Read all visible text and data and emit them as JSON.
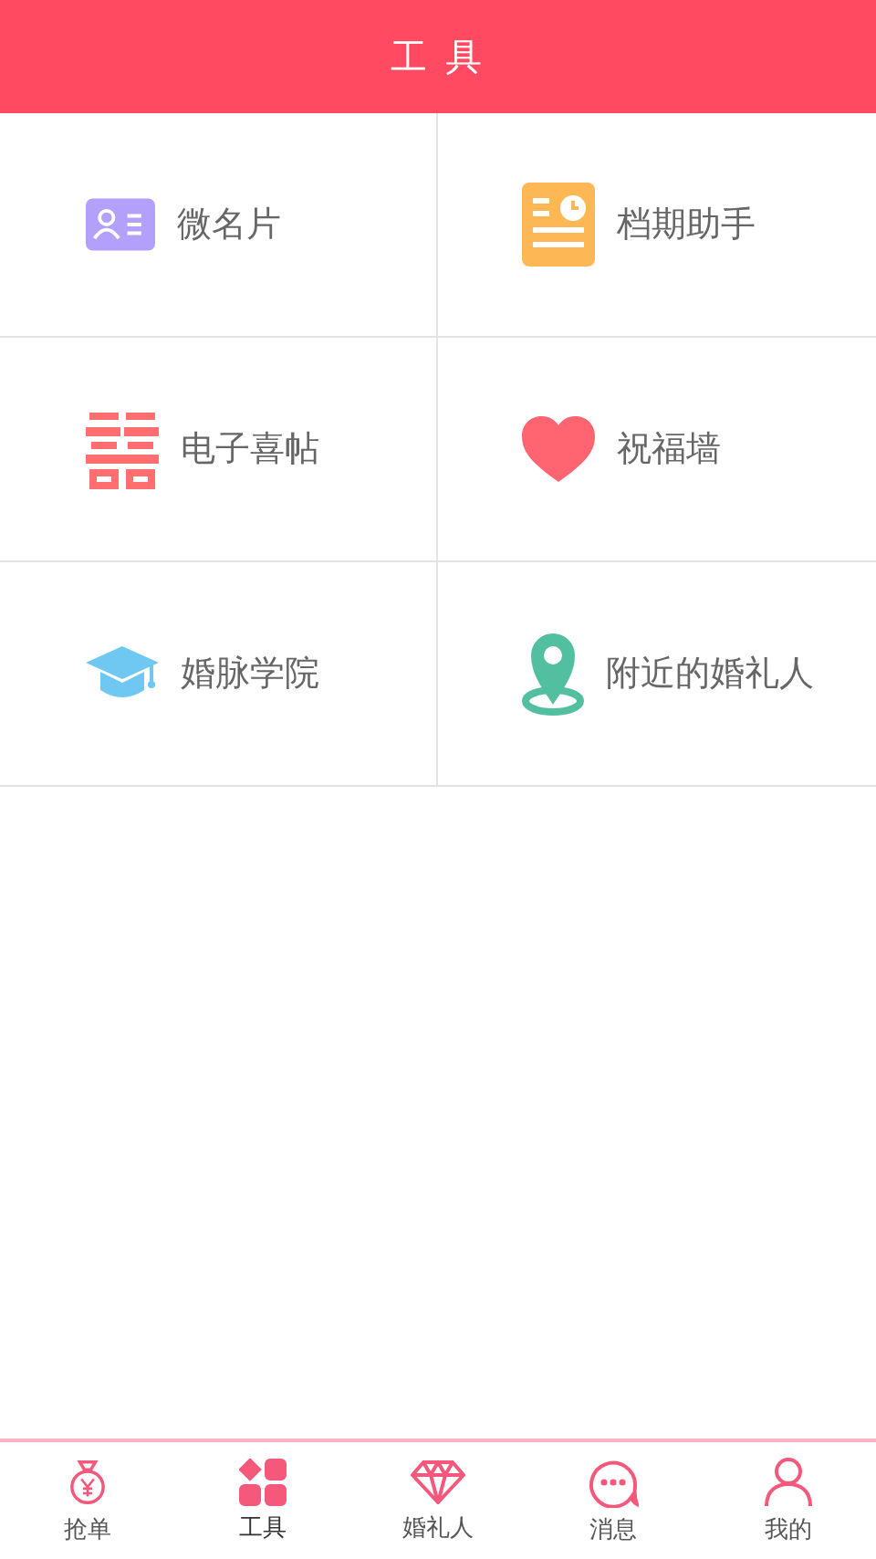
{
  "header": {
    "title": "工 具"
  },
  "tools": [
    {
      "kind": "card",
      "label": "微名片"
    },
    {
      "kind": "schedule",
      "label": "档期助手"
    },
    {
      "kind": "invite",
      "label": "电子喜帖"
    },
    {
      "kind": "heart",
      "label": "祝福墙"
    },
    {
      "kind": "academy",
      "label": "婚脉学院"
    },
    {
      "kind": "nearby",
      "label": "附近的婚礼人"
    }
  ],
  "tabbar": [
    {
      "kind": "bag",
      "label": "抢单",
      "selected": false
    },
    {
      "kind": "tools",
      "label": "工具",
      "selected": true
    },
    {
      "kind": "diamond",
      "label": "婚礼人",
      "selected": false
    },
    {
      "kind": "chat",
      "label": "消息",
      "selected": false
    },
    {
      "kind": "person",
      "label": "我的",
      "selected": false
    }
  ]
}
